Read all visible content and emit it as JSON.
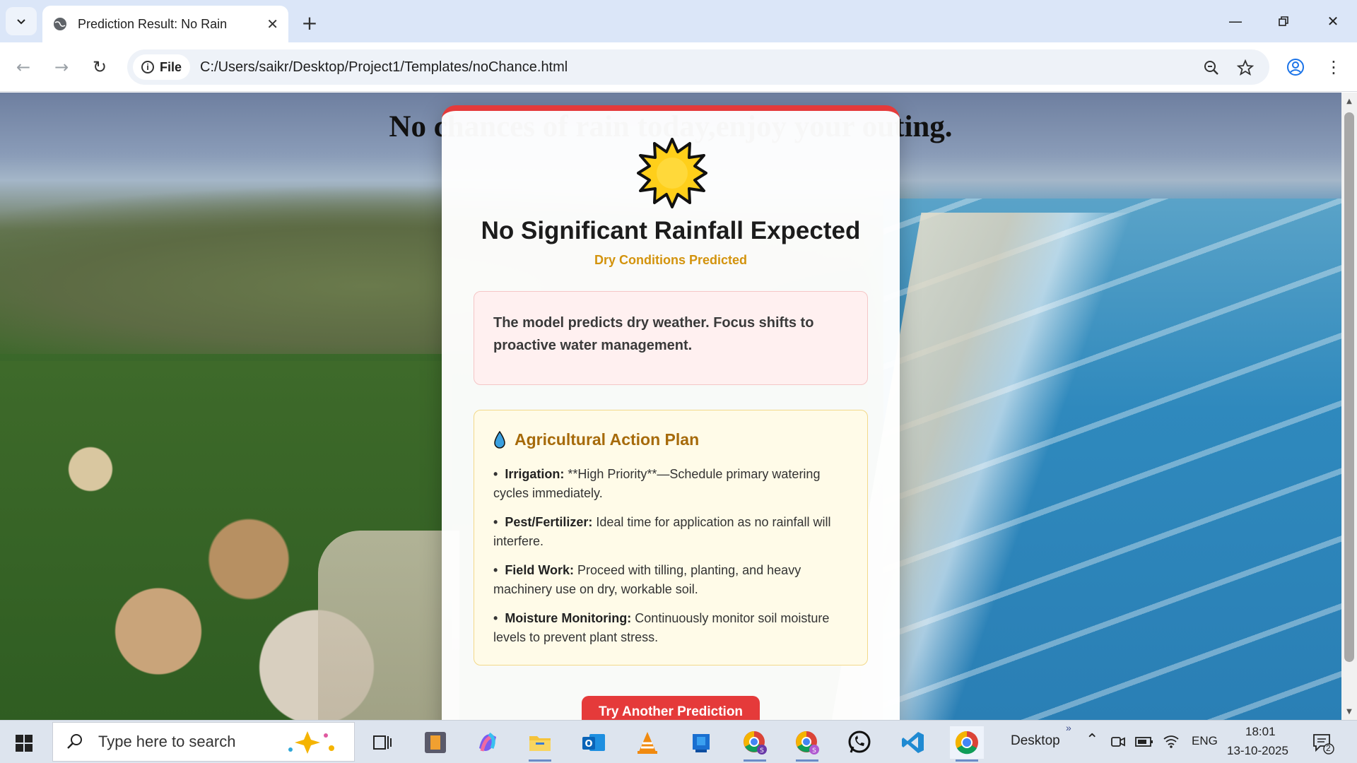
{
  "browser": {
    "tab_title": "Prediction Result: No Rain",
    "site_chip": "File",
    "url": "C:/Users/saikr/Desktop/Project1/Templates/noChance.html"
  },
  "page": {
    "background_heading": "No chances of rain today,enjoy your outing.",
    "card": {
      "icon": "sun-icon",
      "title": "No Significant Rainfall Expected",
      "subtitle": "Dry Conditions Predicted",
      "message": "The model predicts dry weather. Focus shifts to proactive water management.",
      "plan": {
        "icon": "droplet-icon",
        "heading": "Agricultural Action Plan",
        "items": [
          {
            "label": "Irrigation:",
            "text": " **High Priority**—Schedule primary watering cycles immediately."
          },
          {
            "label": "Pest/Fertilizer:",
            "text": " Ideal time for application as no rainfall will interfere."
          },
          {
            "label": "Field Work:",
            "text": " Proceed with tilling, planting, and heavy machinery use on dry, workable soil."
          },
          {
            "label": "Moisture Monitoring:",
            "text": " Continuously monitor soil moisture levels to prevent plant stress."
          }
        ]
      },
      "button": "Try Another Prediction"
    },
    "colors": {
      "accent": "#e53a3a",
      "subtitle": "#d3930d",
      "plan_heading": "#a66a0a"
    }
  },
  "taskbar": {
    "search_placeholder": "Type here to search",
    "desktop_label": "Desktop",
    "language": "ENG",
    "time": "18:01",
    "date": "13-10-2025",
    "notification_count": "2"
  }
}
